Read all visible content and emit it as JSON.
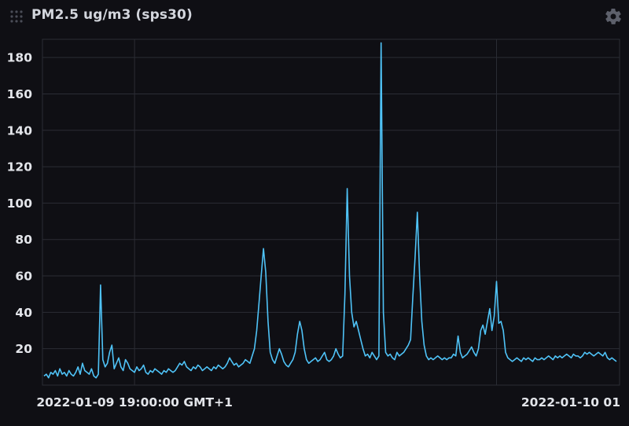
{
  "panel": {
    "title": "PM2.5 ug/m3 (sps30)",
    "icons": {
      "drag": "drag-handle-icon",
      "settings": "gear-icon"
    }
  },
  "colors": {
    "background": "#0f0f14",
    "grid": "#2b2d34",
    "line": "#4fc3f7",
    "text": "#e3e5ea"
  },
  "chart_data": {
    "type": "line",
    "title": "PM2.5 ug/m3 (sps30)",
    "xlabel": "",
    "ylabel": "",
    "ylim": [
      0,
      190
    ],
    "yticks": [
      20,
      40,
      60,
      80,
      100,
      120,
      140,
      160,
      180
    ],
    "xticks": [
      {
        "label": "2022-01-09 19:00:00 GMT+1",
        "index": 40
      },
      {
        "label": "2022-01-10 01",
        "index": 200
      }
    ],
    "grid": true,
    "legend": "none",
    "series": [
      {
        "values": [
          5,
          6,
          4,
          7,
          6,
          8,
          5,
          9,
          6,
          7,
          5,
          8,
          6,
          5,
          7,
          10,
          6,
          12,
          8,
          7,
          6,
          9,
          5,
          4,
          6,
          55,
          14,
          10,
          12,
          18,
          22,
          9,
          12,
          15,
          10,
          8,
          14,
          12,
          9,
          8,
          7,
          10,
          8,
          9,
          11,
          7,
          6,
          8,
          7,
          9,
          8,
          7,
          6,
          8,
          7,
          9,
          8,
          7,
          8,
          10,
          12,
          11,
          13,
          10,
          9,
          8,
          10,
          9,
          11,
          10,
          8,
          9,
          10,
          9,
          8,
          10,
          9,
          11,
          10,
          9,
          10,
          12,
          15,
          13,
          11,
          12,
          10,
          11,
          12,
          14,
          13,
          12,
          16,
          20,
          30,
          45,
          60,
          75,
          62,
          35,
          18,
          14,
          12,
          16,
          20,
          17,
          13,
          11,
          10,
          12,
          14,
          18,
          28,
          35,
          30,
          20,
          14,
          12,
          13,
          14,
          15,
          13,
          14,
          16,
          18,
          14,
          13,
          14,
          16,
          20,
          17,
          15,
          16,
          50,
          108,
          60,
          40,
          32,
          35,
          30,
          25,
          20,
          16,
          17,
          15,
          18,
          16,
          14,
          16,
          188,
          40,
          18,
          16,
          17,
          15,
          14,
          18,
          16,
          17,
          18,
          20,
          22,
          25,
          48,
          70,
          95,
          60,
          35,
          22,
          16,
          14,
          15,
          14,
          15,
          16,
          15,
          14,
          15,
          14,
          15,
          15,
          17,
          16,
          27,
          18,
          15,
          16,
          17,
          19,
          21,
          18,
          16,
          20,
          30,
          33,
          28,
          35,
          42,
          30,
          38,
          57,
          34,
          35,
          30,
          18,
          15,
          14,
          13,
          14,
          15,
          14,
          13,
          15,
          14,
          15,
          14,
          13,
          15,
          14,
          14,
          15,
          14,
          15,
          16,
          15,
          14,
          16,
          15,
          16,
          15,
          16,
          17,
          16,
          15,
          17,
          16,
          16,
          15,
          16,
          18,
          17,
          18,
          17,
          16,
          17,
          18,
          17,
          16,
          18,
          15,
          14,
          15,
          14,
          13
        ]
      }
    ]
  }
}
